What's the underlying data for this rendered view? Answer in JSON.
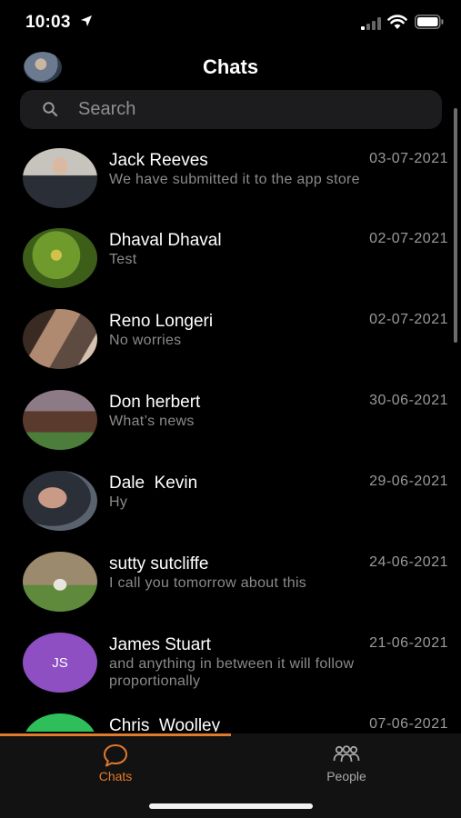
{
  "status_bar": {
    "time": "10:03"
  },
  "header": {
    "title": "Chats"
  },
  "search": {
    "placeholder": "Search"
  },
  "chats": [
    {
      "name": "Jack Reeves",
      "date": "03-07-2021",
      "message": "We have submitted it to the app store",
      "avatar": "photo"
    },
    {
      "name": "Dhaval Dhaval",
      "date": "02-07-2021",
      "message": "Test",
      "avatar": "photo"
    },
    {
      "name": "Reno Longeri",
      "date": "02-07-2021",
      "message": "No worries",
      "avatar": "photo"
    },
    {
      "name": "Don herbert",
      "date": "30-06-2021",
      "message": "What’s news",
      "avatar": "photo"
    },
    {
      "name": "Dale  Kevin",
      "date": "29-06-2021",
      "message": "Hy",
      "avatar": "photo"
    },
    {
      "name": "sutty sutcliffe",
      "date": "24-06-2021",
      "message": "I call you tomorrow about this",
      "avatar": "photo"
    },
    {
      "name": "James Stuart",
      "date": "21-06-2021",
      "message": "and anything in between it will follow proportionally",
      "avatar": "initials",
      "initials": "JS"
    },
    {
      "name": "Chris  Woolley",
      "date": "07-06-2021",
      "message": "",
      "avatar": "photo"
    }
  ],
  "tabs": [
    {
      "label": "Chats",
      "icon": "chat-bubble-icon",
      "active": true
    },
    {
      "label": "People",
      "icon": "people-icon",
      "active": false
    }
  ],
  "colors": {
    "accent": "#e07a2c",
    "background": "#000000",
    "search_bg": "#1c1c1e",
    "initials_avatar": "#8e4fc2"
  }
}
